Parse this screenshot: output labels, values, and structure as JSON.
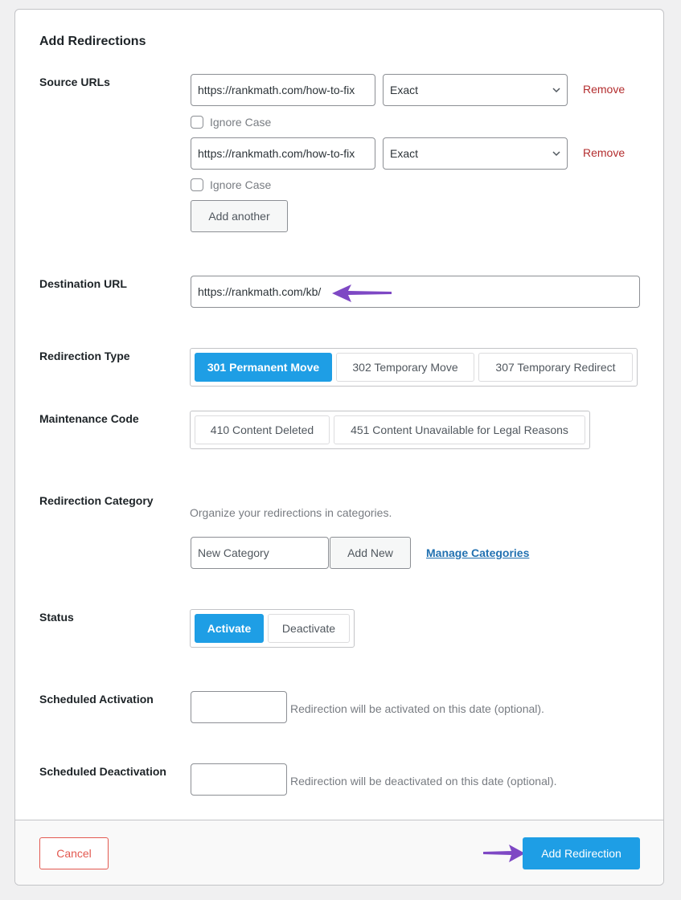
{
  "form": {
    "title": "Add Redirections",
    "source_urls": {
      "label": "Source URLs",
      "rows": [
        {
          "url": "https://rankmath.com/how-to-fix",
          "match": "Exact",
          "ignore_case_label": "Ignore Case",
          "ignore_case": false,
          "remove_label": "Remove"
        },
        {
          "url": "https://rankmath.com/how-to-fix",
          "match": "Exact",
          "ignore_case_label": "Ignore Case",
          "ignore_case": false,
          "remove_label": "Remove"
        }
      ],
      "add_another_label": "Add another"
    },
    "destination": {
      "label": "Destination URL",
      "value": "https://rankmath.com/kb/"
    },
    "redirection_type": {
      "label": "Redirection Type",
      "options": [
        "301 Permanent Move",
        "302 Temporary Move",
        "307 Temporary Redirect"
      ],
      "selected": "301 Permanent Move"
    },
    "maintenance_code": {
      "label": "Maintenance Code",
      "options": [
        "410 Content Deleted",
        "451 Content Unavailable for Legal Reasons"
      ]
    },
    "category": {
      "label": "Redirection Category",
      "description": "Organize your redirections in categories.",
      "input_placeholder": "New Category",
      "add_new_label": "Add New",
      "manage_label": "Manage Categories"
    },
    "status": {
      "label": "Status",
      "options": [
        "Activate",
        "Deactivate"
      ],
      "selected": "Activate"
    },
    "scheduled_activation": {
      "label": "Scheduled Activation",
      "value": "",
      "description": "Redirection will be activated on this date (optional)."
    },
    "scheduled_deactivation": {
      "label": "Scheduled Deactivation",
      "value": "",
      "description": "Redirection will be deactivated on this date (optional)."
    }
  },
  "footer": {
    "cancel_label": "Cancel",
    "submit_label": "Add Redirection"
  },
  "colors": {
    "primary": "#1e9ee5",
    "danger": "#b32d2e",
    "cancel": "#e35950",
    "link": "#2271b1",
    "annotation_arrow": "#7e48c4"
  }
}
